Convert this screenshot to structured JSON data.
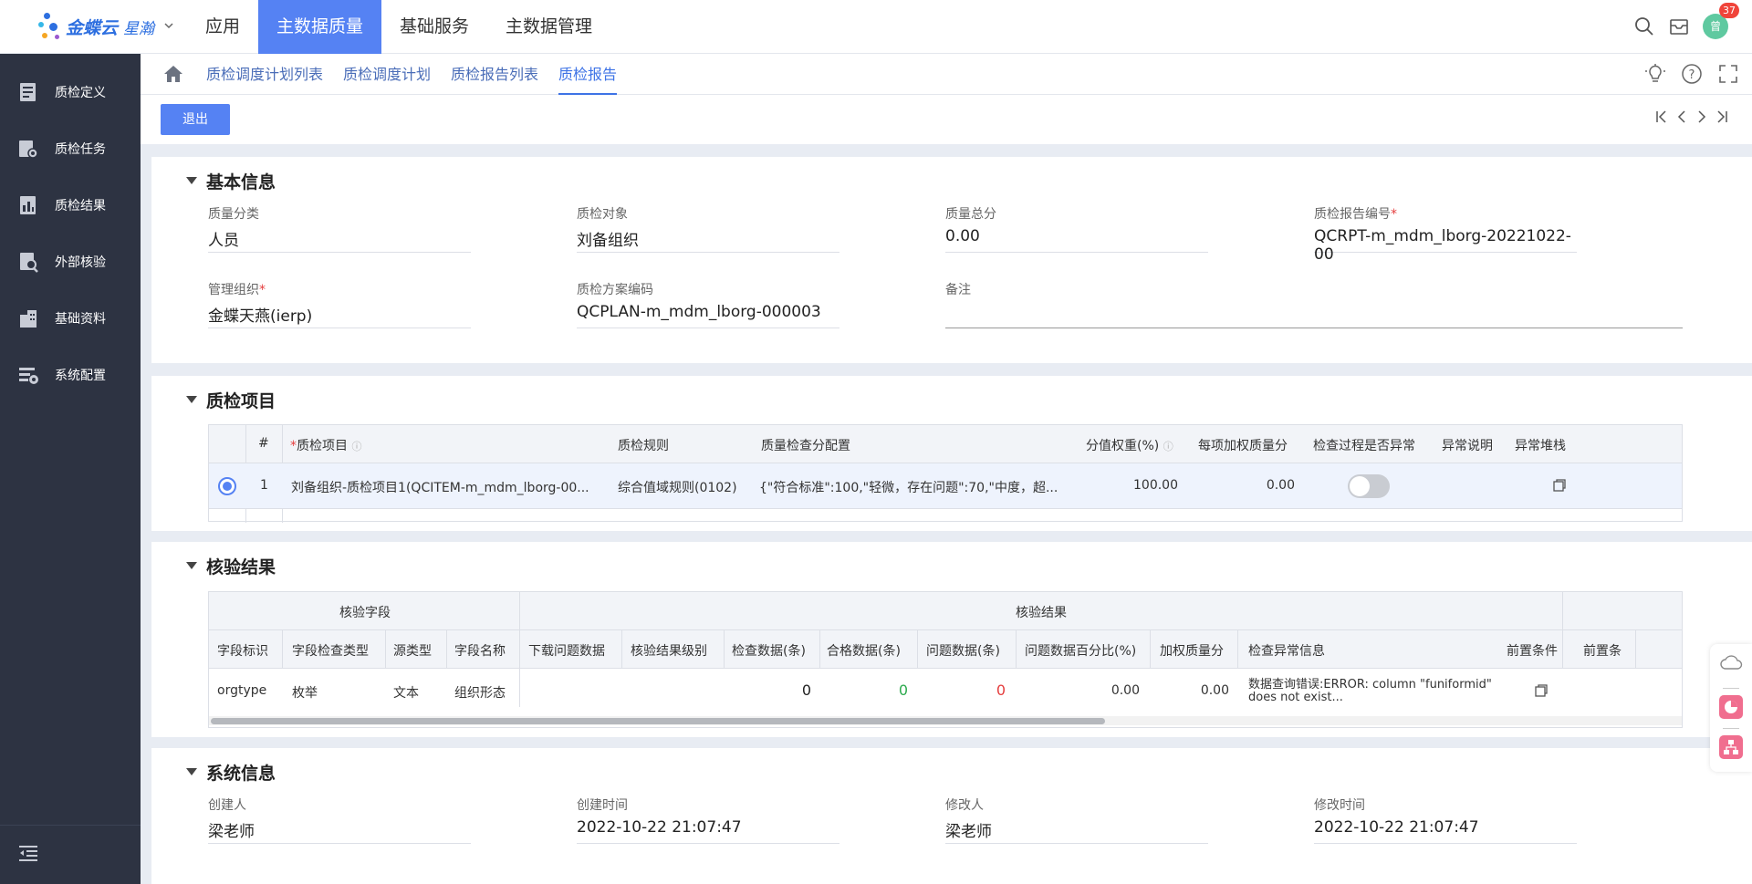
{
  "app": {
    "logo_main": "金蝶云",
    "logo_sub": "星瀚",
    "nav": [
      "应用",
      "主数据质量",
      "基础服务",
      "主数据管理"
    ],
    "active_nav": "主数据质量",
    "avatar_text": "曾",
    "notification_count": "37"
  },
  "sidebar": {
    "items": [
      {
        "label": "质检定义",
        "icon": "document-icon"
      },
      {
        "label": "质检任务",
        "icon": "task-gear-icon"
      },
      {
        "label": "质检结果",
        "icon": "chart-doc-icon"
      },
      {
        "label": "外部核验",
        "icon": "search-doc-icon"
      },
      {
        "label": "基础资料",
        "icon": "building-icon"
      },
      {
        "label": "系统配置",
        "icon": "settings-icon"
      }
    ]
  },
  "breadcrumb": {
    "items": [
      "质检调度计划列表",
      "质检调度计划",
      "质检报告列表",
      "质检报告"
    ],
    "active": "质检报告"
  },
  "toolbar": {
    "exit_label": "退出"
  },
  "basic_info": {
    "title": "基本信息",
    "fields": [
      {
        "label": "质量分类",
        "value": "人员",
        "required": false
      },
      {
        "label": "质检对象",
        "value": "刘备组织",
        "required": false
      },
      {
        "label": "质量总分",
        "value": "0.00",
        "required": false
      },
      {
        "label": "质检报告编号",
        "value": "QCRPT-m_mdm_lborg-20221022-00",
        "required": true
      },
      {
        "label": "管理组织",
        "value": "金蝶天燕(ierp)",
        "required": true
      },
      {
        "label": "质检方案编码",
        "value": "QCPLAN-m_mdm_lborg-000003",
        "required": false
      },
      {
        "label": "备注",
        "value": "",
        "required": false
      }
    ]
  },
  "qc_items": {
    "title": "质检项目",
    "headers": [
      "#",
      "质检项目",
      "质检规则",
      "质量检查分配置",
      "分值权重(%)",
      "每项加权质量分",
      "检查过程是否异常",
      "异常说明",
      "异常堆栈"
    ],
    "rows": [
      {
        "index": "1",
        "item": "刘备组织-质检项目1(QCITEM-m_mdm_lborg-00...",
        "rule": "综合值域规则(0102)",
        "config": "{\"符合标准\":100,\"轻微，存在问题\":70,\"中度，超...",
        "weight": "100.00",
        "weighted_score": "0.00",
        "has_exception": false,
        "exception_desc": "",
        "exception_stack": ""
      }
    ]
  },
  "verify": {
    "title": "核验结果",
    "group_headers": [
      "核验字段",
      "核验结果"
    ],
    "headers": [
      "字段标识",
      "字段检查类型",
      "源类型",
      "字段名称",
      "下载问题数据",
      "核验结果级别",
      "检查数据(条)",
      "合格数据(条)",
      "问题数据(条)",
      "问题数据百分比(%)",
      "加权质量分",
      "检查异常信息",
      "前置条件",
      "前置条"
    ],
    "rows": [
      {
        "field_id": "orgtype",
        "check_type": "枚举",
        "source_type": "文本",
        "field_name": "组织形态",
        "download": "",
        "level": "",
        "checked": "0",
        "passed": "0",
        "problem": "0",
        "problem_pct": "0.00",
        "weighted": "0.00",
        "error_line1": "数据查询错误:ERROR: column \"funiformid\"",
        "error_line2": "does not exist..."
      }
    ]
  },
  "system_info": {
    "title": "系统信息",
    "fields": [
      {
        "label": "创建人",
        "value": "梁老师"
      },
      {
        "label": "创建时间",
        "value": "2022-10-22 21:07:47"
      },
      {
        "label": "修改人",
        "value": "梁老师"
      },
      {
        "label": "修改时间",
        "value": "2022-10-22 21:07:47"
      }
    ]
  },
  "colors": {
    "primary": "#5582f3",
    "sidebar": "#2d3342",
    "passed": "#2eab4f",
    "problem": "#e53e3e"
  }
}
